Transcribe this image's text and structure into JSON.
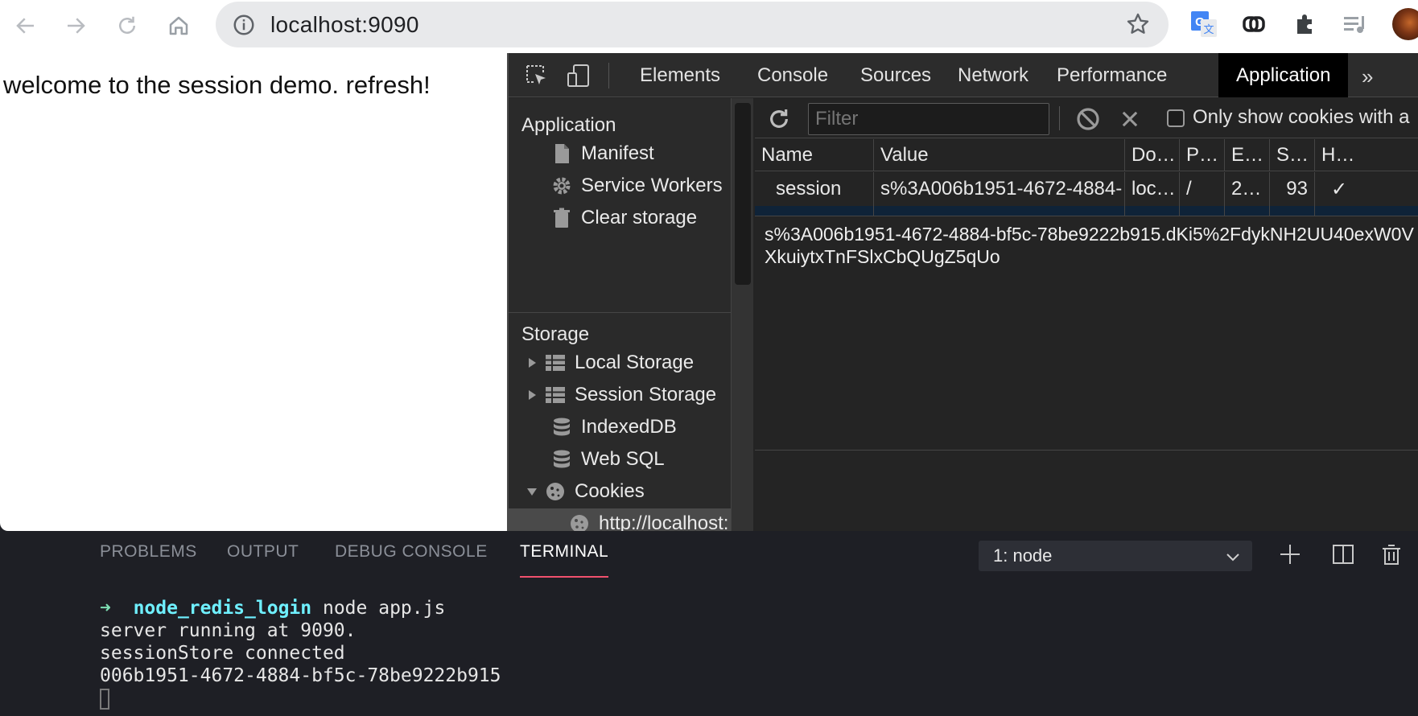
{
  "browser": {
    "url": "localhost:9090",
    "icons": [
      "back-icon",
      "forward-icon",
      "reload-icon",
      "home-icon",
      "info-icon",
      "star-icon",
      "translate-icon",
      "link-icon",
      "extensions-icon",
      "media-icon",
      "avatar"
    ]
  },
  "page": {
    "text": "welcome to the session demo. refresh!"
  },
  "devtools": {
    "tabs": [
      "Elements",
      "Console",
      "Sources",
      "Network",
      "Performance",
      "Application"
    ],
    "active_tab": "Application",
    "more": "»",
    "sidebar": {
      "application_header": "Application",
      "application_items": [
        "Manifest",
        "Service Workers",
        "Clear storage"
      ],
      "storage_header": "Storage",
      "storage_items": [
        "Local Storage",
        "Session Storage",
        "IndexedDB",
        "Web SQL",
        "Cookies"
      ],
      "cookie_origin": "http://localhost:"
    },
    "filter": {
      "placeholder": "Filter",
      "only_show_label": "Only show cookies with a"
    },
    "columns": [
      "Name",
      "Value",
      "Do…",
      "P…",
      "E…",
      "S…",
      "H…"
    ],
    "cookie_row": {
      "name": "session",
      "value": "s%3A006b1951-4672-4884-…",
      "domain": "loc…",
      "path": "/",
      "expires": "2…",
      "size": "93",
      "httponly": "✓"
    },
    "cookie_value_full": "s%3A006b1951-4672-4884-bf5c-78be9222b915.dKi5%2FdykNH2UU40exW0VXkuiytxTnFSlxCbQUgZ5qUo"
  },
  "panel": {
    "tabs": [
      "PROBLEMS",
      "OUTPUT",
      "DEBUG CONSOLE",
      "TERMINAL"
    ],
    "active_tab": "TERMINAL",
    "terminal_select": "1: node",
    "terminal": {
      "prompt_arrow": "➜",
      "prompt_dir": "node_redis_login",
      "command": "node app.js",
      "lines": [
        "server running at 9090.",
        "sessionStore connected",
        "006b1951-4672-4884-bf5c-78be9222b915"
      ]
    }
  },
  "colors": {
    "accent_underline": "#f0516d",
    "terminal_dir": "#6ff0ff",
    "terminal_arrow": "#7ee0b4"
  }
}
